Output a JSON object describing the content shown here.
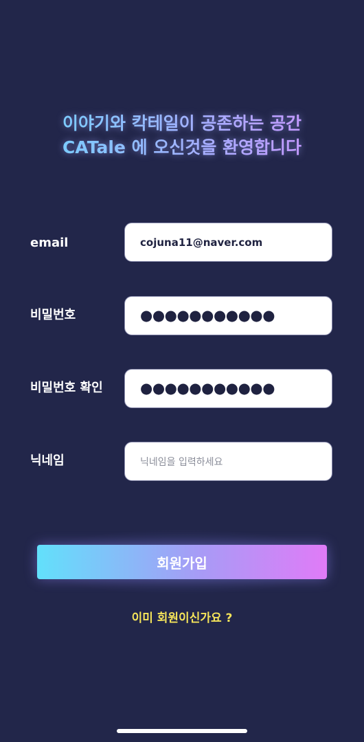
{
  "header": {
    "line1": "이야기와 칵테일이 공존하는 공간",
    "line2": "CATale 에 오신것을 환영합니다"
  },
  "form": {
    "email": {
      "label": "email",
      "value": "cojuna11@naver.com"
    },
    "password": {
      "label": "비밀번호",
      "masked": "●●●●●●●●●●●"
    },
    "password_confirm": {
      "label": "비밀번호 확인",
      "masked": "●●●●●●●●●●●"
    },
    "nickname": {
      "label": "닉네임",
      "placeholder": "닉네임을 입력하세요"
    }
  },
  "actions": {
    "signup_label": "회원가입",
    "login_link": "이미 회원이신가요 ?"
  },
  "colors": {
    "background": "#22264a",
    "gradient_start": "#62e0fb",
    "gradient_end": "#e07bf7",
    "link": "#f5e45a"
  }
}
